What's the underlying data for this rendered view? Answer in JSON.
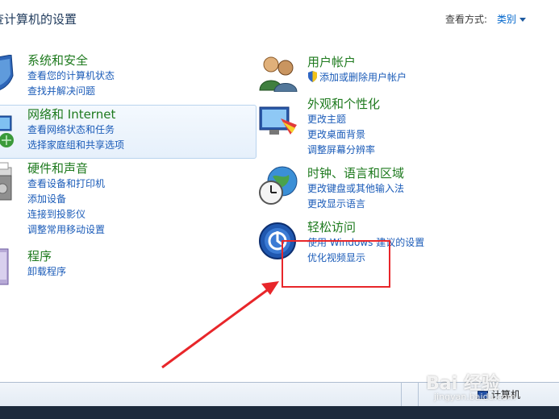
{
  "header": {
    "title": "查计算机的设置",
    "view_by_label": "查看方式:",
    "view_by_value": "类别"
  },
  "left_categories": [
    {
      "title": "系统和安全",
      "links": [
        "查看您的计算机状态",
        "查找并解决问题"
      ]
    },
    {
      "title": "网络和 Internet",
      "links": [
        "查看网络状态和任务",
        "选择家庭组和共享选项"
      ]
    },
    {
      "title": "硬件和声音",
      "links": [
        "查看设备和打印机",
        "添加设备",
        "连接到投影仪",
        "调整常用移动设置"
      ]
    },
    {
      "title": "程序",
      "links": [
        "卸载程序"
      ]
    }
  ],
  "right_categories": [
    {
      "title": "用户帐户",
      "links": [
        "添加或删除用户帐户"
      ]
    },
    {
      "title": "外观和个性化",
      "links": [
        "更改主题",
        "更改桌面背景",
        "调整屏幕分辨率"
      ]
    },
    {
      "title": "时钟、语言和区域",
      "links": [
        "更改键盘或其他输入法",
        "更改显示语言"
      ]
    },
    {
      "title": "轻松访问",
      "links": [
        "使用 Windows 建议的设置",
        "优化视频显示"
      ]
    }
  ],
  "status_bar": {
    "computer_label": "计算机"
  },
  "watermark": {
    "brand": "Bai 经验",
    "url": "jingyan.baidu.com"
  },
  "colors": {
    "category_title": "#1e7a1e",
    "link": "#1a5bb8",
    "annotation": "#e8262a"
  }
}
